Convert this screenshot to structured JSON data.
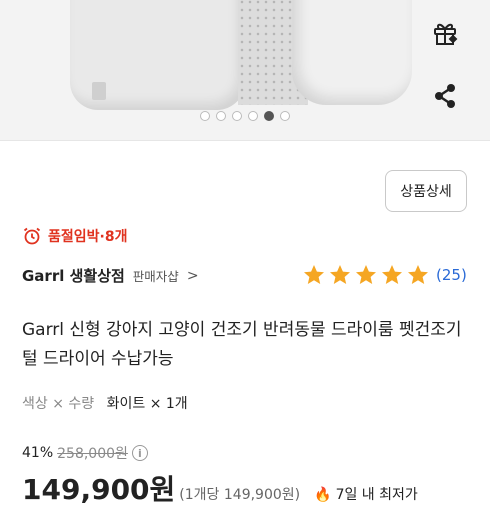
{
  "colors": {
    "accent": "#e0321f",
    "star": "#f5a623",
    "link": "#2a6ad6"
  },
  "hero": {
    "dots": [
      false,
      false,
      false,
      false,
      true,
      false
    ],
    "gift_icon": "gift-icon",
    "share_icon": "share-icon"
  },
  "detail_button": {
    "label": "상품상세"
  },
  "urgent": {
    "icon": "alarm-clock-icon",
    "text": "품절임박·8개"
  },
  "seller": {
    "name": "Garrl 생활상점",
    "badge": "판매자샵",
    "chevron": ">"
  },
  "rating": {
    "stars": 5,
    "count": "(25)"
  },
  "product": {
    "title": "Garrl 신형 강아지 고양이 건조기 반려동물 드라이룸 펫건조기 털 드라이어 수납가능"
  },
  "option": {
    "label": "색상 × 수량",
    "value": "화이트 × 1개"
  },
  "price": {
    "discount": "41%",
    "original": "258,000원",
    "info_icon": "i",
    "final": "149,900원",
    "unit": "(1개당 149,900원)",
    "flame_icon": "fire-icon",
    "badge": "7일 내 최저가"
  }
}
